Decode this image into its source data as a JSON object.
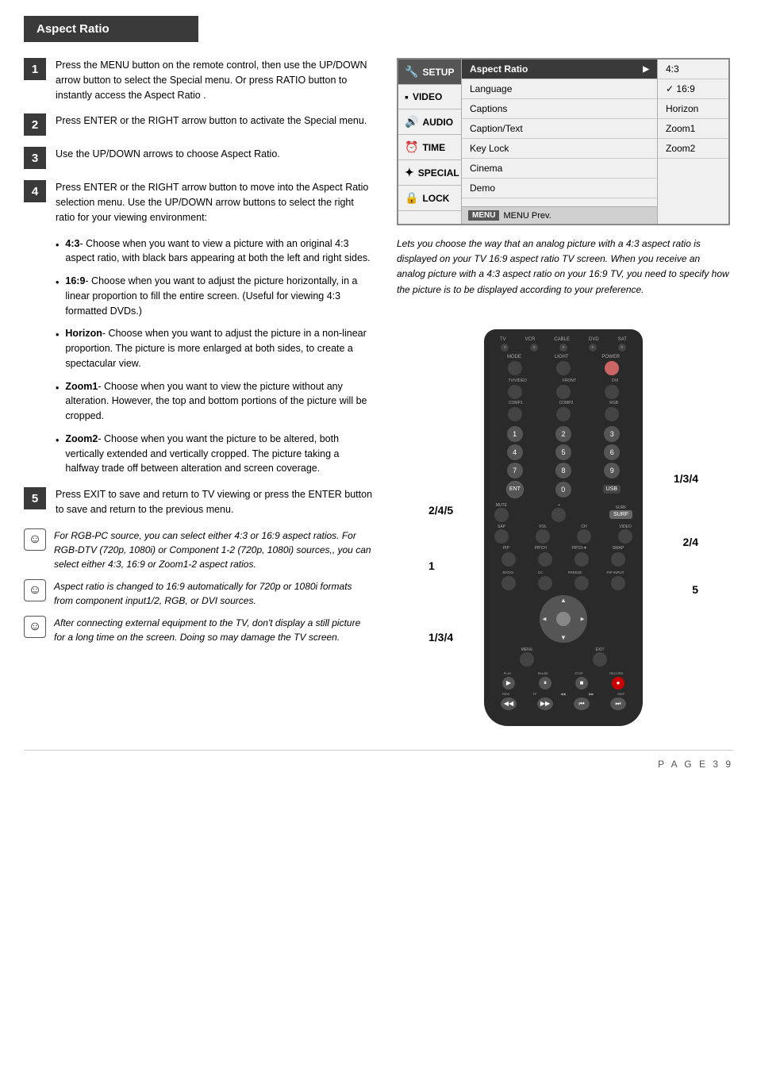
{
  "header": {
    "title": "Aspect Ratio"
  },
  "steps": [
    {
      "num": "1",
      "text": "Press the MENU button on the remote control, then use the UP/DOWN arrow button to select the Special menu. Or press RATIO button to instantly access the Aspect Ratio ."
    },
    {
      "num": "2",
      "text": "Press ENTER or the RIGHT arrow button to activate the Special menu."
    },
    {
      "num": "3",
      "text": "Use the UP/DOWN arrows to choose Aspect Ratio."
    },
    {
      "num": "4",
      "text": "Press ENTER or the RIGHT arrow button to move into the Aspect Ratio selection menu. Use the UP/DOWN arrow buttons to select the right ratio for your viewing environment:"
    },
    {
      "num": "5",
      "text": "Press EXIT to save and return to TV viewing or press the ENTER button to save and return to the previous menu."
    }
  ],
  "bullets": [
    {
      "label": "4:3",
      "text": "- Choose when you want to view a picture with an original 4:3 aspect ratio, with black bars appearing at both the left and right sides."
    },
    {
      "label": "16:9",
      "text": "- Choose when you want to adjust the picture horizontally, in a linear proportion to fill the entire screen. (Useful for viewing 4:3 formatted DVDs.)"
    },
    {
      "label": "Horizon",
      "text": "- Choose when you want to adjust the picture in a non-linear proportion. The picture is more enlarged at both sides, to create a spectacular view."
    },
    {
      "label": "Zoom1",
      "text": "- Choose when you want to view the picture without any alteration. However, the top and bottom portions of the picture will be cropped."
    },
    {
      "label": "Zoom2",
      "text": "- Choose when you want the picture to be altered, both vertically extended and vertically cropped. The picture taking a halfway trade off between alteration and screen coverage."
    }
  ],
  "notes": [
    {
      "text": "For RGB-PC source, you can select either 4:3 or 16:9 aspect ratios.\nFor RGB-DTV (720p, 1080i) or Component 1-2 (720p, 1080i) sources,, you can select either 4:3, 16:9 or Zoom1-2 aspect ratios."
    },
    {
      "text": "Aspect ratio is changed to 16:9 automatically for 720p or 1080i formats from component input1/2, RGB, or DVI sources."
    },
    {
      "text": "After connecting external equipment to the TV, don't display a still picture for a long time on the screen. Doing so may damage the TV screen."
    }
  ],
  "tv_menu": {
    "sidebar_items": [
      {
        "label": "SETUP",
        "icon": "🔧",
        "active": true
      },
      {
        "label": "VIDEO",
        "icon": "▪"
      },
      {
        "label": "AUDIO",
        "icon": "🔊"
      },
      {
        "label": "TIME",
        "icon": "⏰"
      },
      {
        "label": "SPECIAL",
        "icon": "✦"
      },
      {
        "label": "LOCK",
        "icon": "🔒"
      }
    ],
    "menu_items": [
      {
        "label": "Aspect Ratio",
        "selected": true
      },
      {
        "label": "Language"
      },
      {
        "label": "Captions"
      },
      {
        "label": "Caption/Text"
      },
      {
        "label": "Key Lock"
      },
      {
        "label": "Cinema"
      },
      {
        "label": "Demo"
      }
    ],
    "submenu_items": [
      {
        "label": "4:3"
      },
      {
        "label": "16:9",
        "checked": true
      },
      {
        "label": "Horizon"
      },
      {
        "label": "Zoom1"
      },
      {
        "label": "Zoom2"
      }
    ],
    "footer": "MENU  Prev."
  },
  "description": "Lets you choose the way that an analog picture with a 4:3 aspect ratio is displayed on your TV 16:9 aspect ratio TV screen. When you receive an analog picture with a 4:3 aspect ratio on your 16:9 TV, you need to specify how the picture is to be displayed according to your preference.",
  "callouts": {
    "top_right": "1/3/4",
    "mid_right": "2/4",
    "bot_right": "5",
    "mid_left_top": "2/4/5",
    "mid_left_bot": "1",
    "bot_left": "1/3/4"
  },
  "remote": {
    "source_row": [
      "TV",
      "VCR",
      "CABLE",
      "DVD",
      "SAT"
    ],
    "mode_row": [
      "MODE",
      "LIGHT",
      "POWER"
    ],
    "input_row": [
      "TV/VIDEO",
      "FRONT",
      "DVI"
    ],
    "comp_row": [
      "COMP1",
      "COMP2",
      "RGB"
    ],
    "nums": [
      "1",
      "2",
      "3",
      "4",
      "5",
      "6",
      "7",
      "8",
      "9",
      "ENTER",
      "0",
      "(USB)"
    ],
    "mute": "MUTE",
    "surf": "SURF",
    "sap": "SAP",
    "video": "VIDEO",
    "vol": "VOL",
    "ch": "CH",
    "pip_row": [
      "PIP",
      "PIPCH",
      "PIPCh▼",
      "SWAP"
    ],
    "bottom_row": [
      "RATIO",
      "CC",
      "FREEZE",
      "PIP INPUT"
    ],
    "nav_center": "⊙",
    "transport": [
      "PLAY",
      "PAUSE",
      "STOP",
      "RECORD"
    ],
    "transport2": [
      "REW",
      "FF",
      "◀◀",
      "▶▶",
      "SKIP"
    ]
  },
  "page_footer": "P A G E   3 9"
}
